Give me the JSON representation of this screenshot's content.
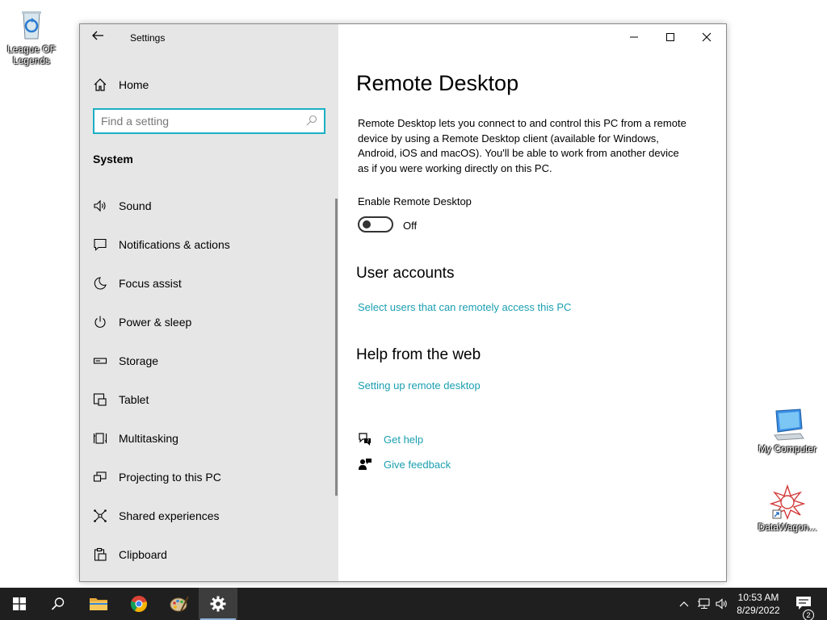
{
  "desktop": {
    "icons": [
      {
        "label": "League OF Legends"
      },
      {
        "label": "My Computer"
      },
      {
        "label": "DataWagon..."
      }
    ]
  },
  "window": {
    "app_title": "Settings",
    "sidebar": {
      "home_label": "Home",
      "search_placeholder": "Find a setting",
      "section_title": "System",
      "items": [
        {
          "label": "Sound",
          "icon": "speaker-icon"
        },
        {
          "label": "Notifications & actions",
          "icon": "message-icon"
        },
        {
          "label": "Focus assist",
          "icon": "moon-icon"
        },
        {
          "label": "Power & sleep",
          "icon": "power-icon"
        },
        {
          "label": "Storage",
          "icon": "storage-icon"
        },
        {
          "label": "Tablet",
          "icon": "tablet-icon"
        },
        {
          "label": "Multitasking",
          "icon": "multitasking-icon"
        },
        {
          "label": "Projecting to this PC",
          "icon": "projector-icon"
        },
        {
          "label": "Shared experiences",
          "icon": "share-icon"
        },
        {
          "label": "Clipboard",
          "icon": "clipboard-icon"
        }
      ]
    },
    "content": {
      "title": "Remote Desktop",
      "description": "Remote Desktop lets you connect to and control this PC from a remote device by using a Remote Desktop client (available for Windows, Android, iOS and macOS). You'll be able to work from another device as if you were working directly on this PC.",
      "toggle_label": "Enable Remote Desktop",
      "toggle_state": "Off",
      "user_accounts_heading": "User accounts",
      "user_accounts_link": "Select users that can remotely access this PC",
      "help_heading": "Help from the web",
      "help_link": "Setting up remote desktop",
      "get_help": "Get help",
      "give_feedback": "Give feedback"
    }
  },
  "taskbar": {
    "time": "10:53 AM",
    "date": "8/29/2022",
    "notification_count": "2"
  },
  "colors": {
    "accent": "#1bb0c4",
    "link": "#1a9fb0",
    "sidebar_bg": "#e6e6e6",
    "taskbar_bg": "#1f1f1f"
  }
}
